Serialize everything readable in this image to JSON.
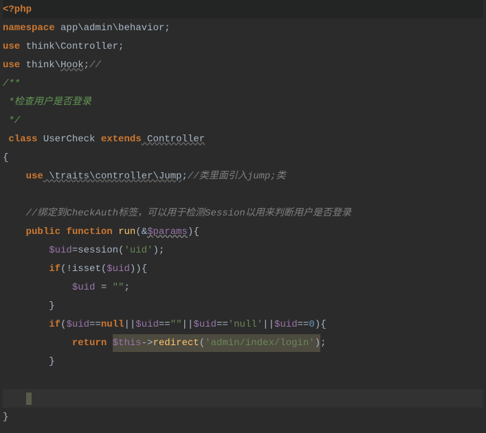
{
  "code": {
    "php_open": "<?php",
    "ns_kw": "namespace",
    "ns_path": " app\\admin\\behavior",
    "semi": ";",
    "use_kw": "use",
    "use1_path": " think\\Controller",
    "use2_path_a": " think\\",
    "use2_path_b": "Hook",
    "use2_tail": ";",
    "slashslash": "//",
    "doc_open": "/**",
    "doc_line": " *检查用户是否登录",
    "doc_close": " */",
    "class_kw": "class",
    "class_name": " UserCheck ",
    "extends_kw": "extends",
    "ext_name": " Controller",
    "brace_open": "{",
    "brace_close": "}",
    "use_trait_kw": "use",
    "use_trait_path": " \\traits\\controller\\Jump",
    "use_trait_comment": "//类里面引入jump;类",
    "bind_comment": "//绑定到CheckAuth标签，可以用于检测Session以用来判断用户是否登录",
    "public_kw": "public",
    "function_kw": "function",
    "fn_name": "run",
    "amp": "&",
    "param": "$params",
    "paren_open": "(",
    "paren_close": ")",
    "uid_var": "$uid",
    "eq": "=",
    "session_fn": "session",
    "uid_str": "'uid'",
    "if_kw": "if",
    "not": "!",
    "isset_fn": "isset",
    "empty_str": "\"\"",
    "eqeq": "==",
    "null_kw": "null",
    "or": "||",
    "null_str": "'null'",
    "zero": "0",
    "return_kw": "return",
    "this_var": "$this",
    "arrow": "->",
    "redirect_fn": "redirect",
    "redirect_arg": "'admin/index/login'",
    "space1": " ",
    "space4": "    ",
    "space8": "        ",
    "space12": "            "
  }
}
